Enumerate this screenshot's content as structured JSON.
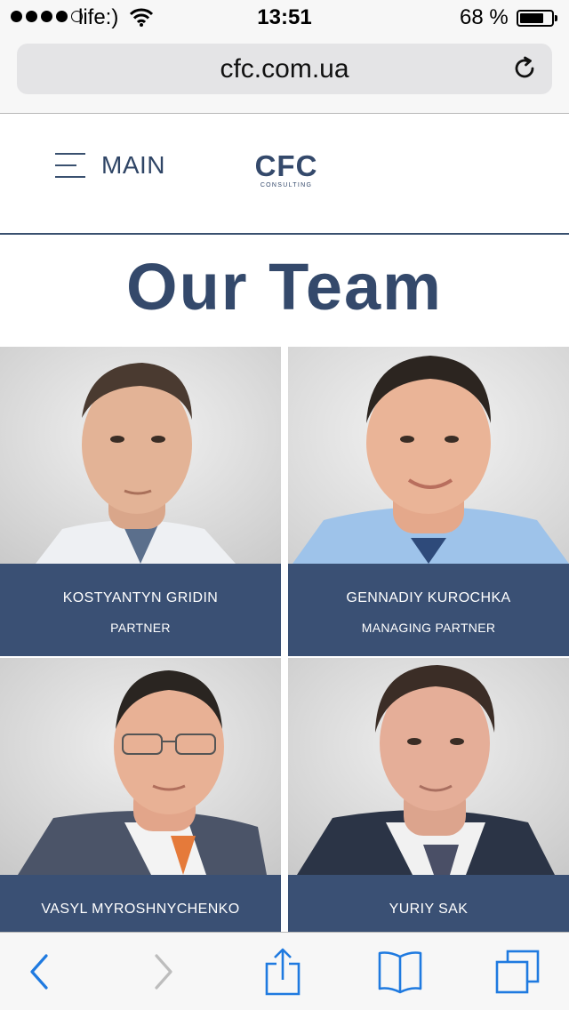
{
  "status_bar": {
    "carrier": "life:)",
    "time": "13:51",
    "battery_percent": "68 %",
    "battery_level": 0.68,
    "signal_bars_filled": 4,
    "signal_bars_total": 5
  },
  "browser": {
    "url": "cfc.com.ua",
    "reload_icon": "reload-icon"
  },
  "site": {
    "menu_label": "MAIN",
    "logo_text": "CFC",
    "logo_subtext": "CONSULTING",
    "page_title": "Our Team"
  },
  "team": [
    {
      "name": "KOSTYANTYN GRIDIN",
      "role": "PARTNER"
    },
    {
      "name": "GENNADIY KUROCHKA",
      "role": "MANAGING PARTNER"
    },
    {
      "name": "VASYL MYROSHNYCHENKO",
      "role": ""
    },
    {
      "name": "YURIY SAK",
      "role": ""
    }
  ],
  "colors": {
    "brand_navy": "#3a5074",
    "ios_blue": "#1f7ae0",
    "toolbar_bg": "#f7f7f7"
  },
  "toolbar": {
    "icons": [
      "back-icon",
      "forward-icon",
      "share-icon",
      "bookmarks-icon",
      "tabs-icon"
    ]
  }
}
